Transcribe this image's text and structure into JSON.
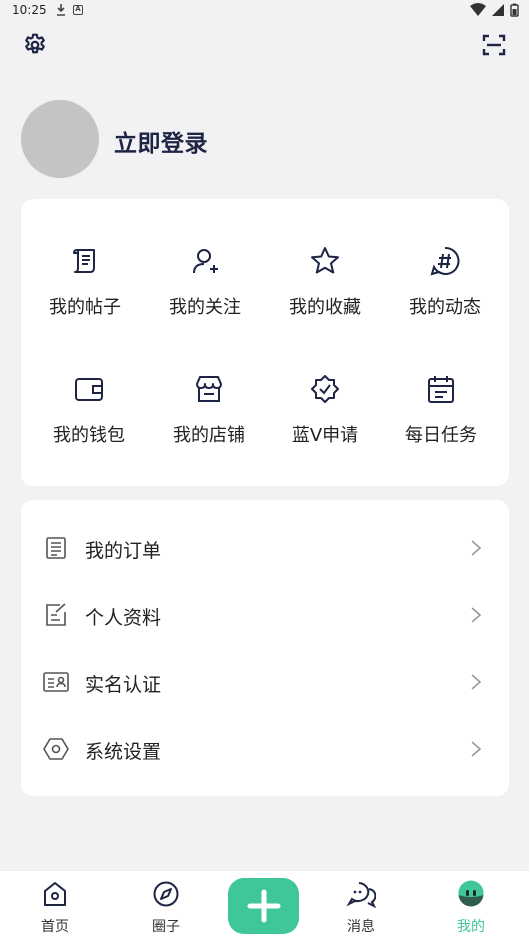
{
  "status_bar": {
    "time": "10:25",
    "a_badge": "A"
  },
  "header": {
    "settings_icon": "gear-icon",
    "scan_icon": "scan-icon"
  },
  "profile": {
    "login_text": "立即登录"
  },
  "grid": [
    {
      "label": "我的帖子",
      "icon": "post-icon"
    },
    {
      "label": "我的关注",
      "icon": "follow-user-icon"
    },
    {
      "label": "我的收藏",
      "icon": "star-icon"
    },
    {
      "label": "我的动态",
      "icon": "hashtag-icon"
    },
    {
      "label": "我的钱包",
      "icon": "wallet-icon"
    },
    {
      "label": "我的店铺",
      "icon": "shop-icon"
    },
    {
      "label": "蓝V申请",
      "icon": "verified-badge-icon"
    },
    {
      "label": "每日任务",
      "icon": "calendar-icon"
    }
  ],
  "list": [
    {
      "label": "我的订单",
      "icon": "order-icon"
    },
    {
      "label": "个人资料",
      "icon": "edit-profile-icon"
    },
    {
      "label": "实名认证",
      "icon": "id-card-icon"
    },
    {
      "label": "系统设置",
      "icon": "hexagon-settings-icon"
    }
  ],
  "nav": {
    "home": "首页",
    "circle": "圈子",
    "messages": "消息",
    "mine": "我的",
    "active": "mine",
    "accent_color": "#3fc79a"
  }
}
